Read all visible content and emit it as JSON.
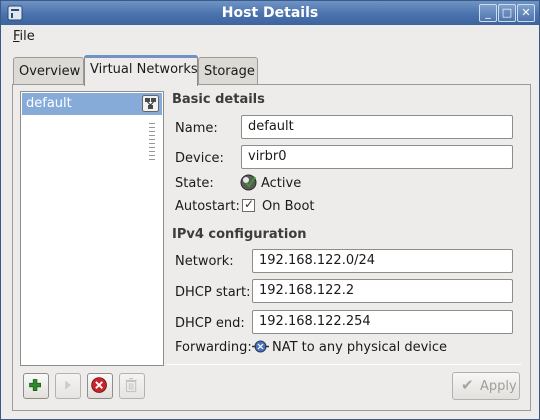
{
  "window": {
    "title": "Host Details",
    "controls": {
      "minimize": "_",
      "maximize": "□",
      "close": "✕"
    }
  },
  "menubar": {
    "file_prefix": "F",
    "file_rest": "ile"
  },
  "tabs": [
    {
      "label": "Overview",
      "active": false
    },
    {
      "label": "Virtual Networks",
      "active": true
    },
    {
      "label": "Storage",
      "active": false
    }
  ],
  "network_list": {
    "items": [
      {
        "label": "default",
        "icon": "network-icon",
        "selected": true
      }
    ]
  },
  "basic_details": {
    "heading": "Basic details",
    "name_label": "Name:",
    "name_value": "default",
    "device_label": "Device:",
    "device_value": "virbr0",
    "state_label": "State:",
    "state_value": "Active",
    "state_icon": "running-state-icon",
    "autostart_label": "Autostart:",
    "autostart_checkbox_label": "On Boot",
    "autostart_checked": true
  },
  "ipv4": {
    "heading": "IPv4 configuration",
    "network_label": "Network:",
    "network_value": "192.168.122.0/24",
    "dhcp_start_label": "DHCP start:",
    "dhcp_start_value": "192.168.122.2",
    "dhcp_end_label": "DHCP end:",
    "dhcp_end_value": "192.168.122.254",
    "forwarding_label": "Forwarding:",
    "forwarding_value": "NAT to any physical device",
    "forwarding_icon": "nat-routing-icon"
  },
  "toolbar": {
    "add_icon": "plus-icon",
    "start_icon": "play-icon",
    "stop_icon": "stop-icon",
    "delete_icon": "trash-icon"
  },
  "apply_button": {
    "label": "Apply",
    "enabled": false
  },
  "colors": {
    "titlebar": "#4a72ad",
    "selection": "#86abd9",
    "add_green": "#2f8a2b",
    "stop_red": "#c8252a"
  }
}
